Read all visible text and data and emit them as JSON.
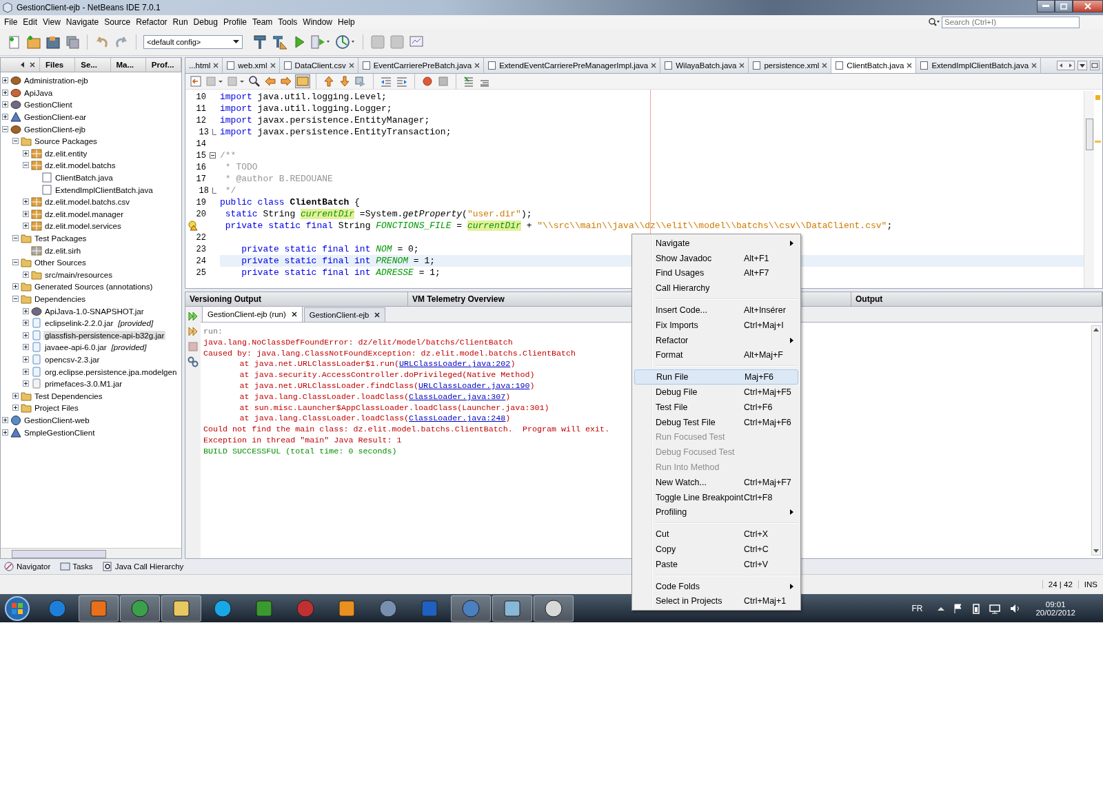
{
  "window": {
    "title": "GestionClient-ejb - NetBeans IDE 7.0.1"
  },
  "menu": [
    "File",
    "Edit",
    "View",
    "Navigate",
    "Source",
    "Refactor",
    "Run",
    "Debug",
    "Profile",
    "Team",
    "Tools",
    "Window",
    "Help"
  ],
  "search": {
    "placeholder": "Search (Ctrl+I)"
  },
  "toolbar": {
    "config": "<default config>"
  },
  "projects": {
    "tabs": [
      {
        "label": "Files",
        "selected": false
      },
      {
        "label": "Se...",
        "selected": false
      },
      {
        "label": "Ma...",
        "selected": false
      },
      {
        "label": "Prof...",
        "selected": false
      }
    ],
    "tree": [
      {
        "label": "Administration-ejb",
        "kind": "ejb",
        "expanded": false,
        "selected": false
      },
      {
        "label": "ApiJava",
        "kind": "javaapp",
        "expanded": false,
        "selected": false
      },
      {
        "label": "GestionClient",
        "kind": "maven",
        "expanded": false,
        "selected": false
      },
      {
        "label": "GestionClient-ear",
        "kind": "ear",
        "expanded": false,
        "selected": false
      },
      {
        "label": "GestionClient-ejb",
        "kind": "ejb",
        "expanded": true,
        "selected": false,
        "children": [
          {
            "label": "Source Packages",
            "kind": "folder",
            "expanded": true,
            "selected": false,
            "children": [
              {
                "label": "dz.elit.entity",
                "kind": "package",
                "expanded": false,
                "selected": false
              },
              {
                "label": "dz.elit.model.batchs",
                "kind": "package",
                "expanded": true,
                "selected": false,
                "children": [
                  {
                    "label": "ClientBatch.java",
                    "kind": "java",
                    "selected": false
                  },
                  {
                    "label": "ExtendImplClientBatch.java",
                    "kind": "java",
                    "selected": false
                  }
                ]
              },
              {
                "label": "dz.elit.model.batchs.csv",
                "kind": "package",
                "expanded": false,
                "selected": false
              },
              {
                "label": "dz.elit.model.manager",
                "kind": "package",
                "expanded": false,
                "selected": false
              },
              {
                "label": "dz.elit.model.services",
                "kind": "package",
                "expanded": false,
                "selected": false
              }
            ]
          },
          {
            "label": "Test Packages",
            "kind": "folder",
            "expanded": true,
            "selected": false,
            "children": [
              {
                "label": "dz.elit.sirh",
                "kind": "empty-package",
                "selected": false
              }
            ]
          },
          {
            "label": "Other Sources",
            "kind": "folder",
            "expanded": true,
            "selected": false,
            "children": [
              {
                "label": "src/main/resources",
                "kind": "folder",
                "expanded": false,
                "selected": false
              }
            ]
          },
          {
            "label": "Generated Sources (annotations)",
            "kind": "folder",
            "expanded": false,
            "selected": false
          },
          {
            "label": "Dependencies",
            "kind": "folder",
            "expanded": true,
            "selected": false,
            "children": [
              {
                "label": "ApiJava-1.0-SNAPSHOT.jar",
                "kind": "maven",
                "expanded": false,
                "selected": false
              },
              {
                "label": "eclipselink-2.2.0.jar",
                "note": "[provided]",
                "kind": "jar",
                "expanded": false,
                "selected": false
              },
              {
                "label": "glassfish-persistence-api-b32g.jar",
                "kind": "jar",
                "expanded": false,
                "selected": true
              },
              {
                "label": "javaee-api-6.0.jar",
                "note": "[provided]",
                "kind": "jar",
                "expanded": false,
                "selected": false
              },
              {
                "label": "opencsv-2.3.jar",
                "kind": "jar",
                "expanded": false,
                "selected": false
              },
              {
                "label": "org.eclipse.persistence.jpa.modelgen",
                "kind": "jar",
                "expanded": false,
                "selected": false
              },
              {
                "label": "primefaces-3.0.M1.jar",
                "kind": "jar-grey",
                "expanded": false,
                "selected": false
              }
            ]
          },
          {
            "label": "Test Dependencies",
            "kind": "folder",
            "expanded": false,
            "selected": false
          },
          {
            "label": "Project Files",
            "kind": "folder",
            "expanded": false,
            "selected": false
          }
        ]
      },
      {
        "label": "GestionClient-web",
        "kind": "web",
        "expanded": false,
        "selected": false
      },
      {
        "label": "SmpleGestionClient",
        "kind": "ear",
        "expanded": false,
        "selected": false
      }
    ]
  },
  "editor": {
    "tabs": [
      {
        "label": "...html",
        "selected": false
      },
      {
        "label": "web.xml",
        "selected": false
      },
      {
        "label": "DataClient.csv",
        "selected": false
      },
      {
        "label": "EventCarrierePreBatch.java",
        "selected": false
      },
      {
        "label": "ExtendEventCarrierePreManagerImpl.java",
        "selected": false
      },
      {
        "label": "WilayaBatch.java",
        "selected": false
      },
      {
        "label": "persistence.xml",
        "selected": false
      },
      {
        "label": "ClientBatch.java",
        "selected": true
      },
      {
        "label": "ExtendImplClientBatch.java",
        "selected": false
      }
    ],
    "lines": [
      {
        "number": "10",
        "kind": "plain",
        "current": false,
        "tokens": [
          {
            "kind": "kw",
            "text": "import"
          },
          {
            "kind": "plain",
            "text": " java.util.logging.Level;"
          }
        ]
      },
      {
        "number": "11",
        "kind": "plain",
        "current": false,
        "tokens": [
          {
            "kind": "kw",
            "text": "import"
          },
          {
            "kind": "plain",
            "text": " java.util.logging.Logger;"
          }
        ]
      },
      {
        "number": "12",
        "kind": "plain",
        "current": false,
        "tokens": [
          {
            "kind": "kw",
            "text": "import"
          },
          {
            "kind": "plain",
            "text": " javax.persistence.EntityManager;"
          }
        ]
      },
      {
        "number": "13",
        "kind": "fold-end",
        "current": false,
        "tokens": [
          {
            "kind": "kw",
            "text": "import"
          },
          {
            "kind": "plain",
            "text": " javax.persistence.EntityTransaction;"
          }
        ]
      },
      {
        "number": "14",
        "kind": "plain",
        "current": false
      },
      {
        "number": "15",
        "kind": "fold-start",
        "current": false,
        "tokens": [
          {
            "kind": "comment",
            "text": "/**"
          }
        ]
      },
      {
        "number": "16",
        "kind": "plain",
        "current": false,
        "tokens": [
          {
            "kind": "comment",
            "text": " * TODO"
          }
        ]
      },
      {
        "number": "17",
        "kind": "plain",
        "current": false,
        "tokens": [
          {
            "kind": "comment",
            "text": " * @author B.REDOUANE"
          }
        ]
      },
      {
        "number": "18",
        "kind": "fold-end",
        "current": false,
        "tokens": [
          {
            "kind": "comment",
            "text": " */"
          }
        ]
      },
      {
        "number": "19",
        "kind": "plain",
        "current": false,
        "tokens": [
          {
            "kind": "kw",
            "text": "public class "
          },
          {
            "kind": "bold",
            "text": "ClientBatch"
          },
          {
            "kind": "plain",
            "text": " {"
          }
        ]
      },
      {
        "number": "20",
        "kind": "plain",
        "current": false,
        "tokens": [
          {
            "kind": "kw",
            "text": " static"
          },
          {
            "kind": "plain",
            "text": " String "
          },
          {
            "kind": "mark",
            "text": "currentDir"
          },
          {
            "kind": "plain",
            "text": " =System."
          },
          {
            "kind": "italic",
            "text": "getProperty"
          },
          {
            "kind": "plain",
            "text": "("
          },
          {
            "kind": "string",
            "text": "\"user.dir\""
          },
          {
            "kind": "plain",
            "text": ");"
          }
        ]
      },
      {
        "kind": "warning",
        "current": false,
        "tokens": [
          {
            "kind": "kw",
            "text": " private static final"
          },
          {
            "kind": "plain",
            "text": " String "
          },
          {
            "kind": "field",
            "text": "FONCTIONS_FILE"
          },
          {
            "kind": "plain",
            "text": " = "
          },
          {
            "kind": "mark",
            "text": "currentDir"
          },
          {
            "kind": "plain",
            "text": " + "
          },
          {
            "kind": "string",
            "text": "\"\\\\src\\\\main\\\\java\\\\dz\\\\elit\\\\model\\\\batchs\\\\csv\\\\DataClient.csv\""
          },
          {
            "kind": "plain",
            "text": ";"
          }
        ]
      },
      {
        "number": "22",
        "kind": "plain",
        "current": false
      },
      {
        "number": "23",
        "kind": "plain",
        "current": false,
        "tokens": [
          {
            "kind": "kw",
            "text": "    private static final int "
          },
          {
            "kind": "field",
            "text": "NOM"
          },
          {
            "kind": "plain",
            "text": " = 0;"
          }
        ]
      },
      {
        "number": "24",
        "kind": "plain",
        "current": true,
        "tokens": [
          {
            "kind": "kw",
            "text": "    private static final int "
          },
          {
            "kind": "field",
            "text": "PRENOM"
          },
          {
            "kind": "plain",
            "text": " = 1;"
          }
        ]
      },
      {
        "number": "25",
        "kind": "plain",
        "current": false,
        "tokens": [
          {
            "kind": "kw",
            "text": "    private static final int "
          },
          {
            "kind": "field",
            "text": "ADRESSE"
          },
          {
            "kind": "plain",
            "text": " = 1;"
          }
        ]
      }
    ]
  },
  "panels": [
    "Versioning Output",
    "VM Telemetry Overview",
    "Output"
  ],
  "output": {
    "tabs": [
      {
        "label": "GestionClient-ejb (run)",
        "selected": true
      },
      {
        "label": "GestionClient-ejb",
        "selected": false
      }
    ],
    "lines": [
      {
        "kind": "info",
        "parts": [
          {
            "text": "run:"
          }
        ]
      },
      {
        "kind": "error",
        "parts": [
          {
            "text": "java.lang.NoClassDefFoundError: dz/elit/model/batchs/ClientBatch"
          }
        ]
      },
      {
        "kind": "error",
        "parts": [
          {
            "text": "Caused by: java.lang.ClassNotFoundException: dz.elit.model.batchs.ClientBatch"
          }
        ]
      },
      {
        "kind": "trace",
        "parts": [
          {
            "text": "at java.net.URLClassLoader$1.run("
          },
          {
            "text": "URLClassLoader.java:202",
            "link": true
          },
          {
            "text": ")"
          }
        ]
      },
      {
        "kind": "trace",
        "parts": [
          {
            "text": "at java.security.AccessController.doPrivileged(Native Method)"
          }
        ]
      },
      {
        "kind": "trace",
        "parts": [
          {
            "text": "at java.net.URLClassLoader.findClass("
          },
          {
            "text": "URLClassLoader.java:190",
            "link": true
          },
          {
            "text": ")"
          }
        ]
      },
      {
        "kind": "trace",
        "parts": [
          {
            "text": "at java.lang.ClassLoader.loadClass("
          },
          {
            "text": "ClassLoader.java:307",
            "link": true
          },
          {
            "text": ")"
          }
        ]
      },
      {
        "kind": "trace",
        "parts": [
          {
            "text": "at sun.misc.Launcher$AppClassLoader.loadClass(Launcher.java:301)"
          }
        ]
      },
      {
        "kind": "trace",
        "parts": [
          {
            "text": "at java.lang.ClassLoader.loadClass("
          },
          {
            "text": "ClassLoader.java:248",
            "link": true
          },
          {
            "text": ")"
          }
        ]
      },
      {
        "kind": "error",
        "parts": [
          {
            "text": "Could not find the main class: dz.elit.model.batchs.ClientBatch.  Program will exit."
          }
        ]
      },
      {
        "kind": "error",
        "parts": [
          {
            "text": "Exception in thread \"main\" Java Result: 1"
          }
        ]
      },
      {
        "kind": "success",
        "parts": [
          {
            "text": "BUILD SUCCESSFUL (total time: 0 seconds)"
          }
        ]
      }
    ]
  },
  "bottom_tabs": [
    "Navigator",
    "Tasks",
    "Java Call Hierarchy"
  ],
  "status_bar": {
    "position": "24 | 42",
    "mode": "INS"
  },
  "tray": {
    "language": "FR",
    "time": "09:01",
    "date": "20/02/2012"
  },
  "context_menu": [
    [
      {
        "label": "Navigate",
        "submenu": true,
        "disabled": false,
        "selected": false
      },
      {
        "label": "Show Javadoc",
        "shortcut": "Alt+F1",
        "submenu": false,
        "disabled": false,
        "selected": false
      },
      {
        "label": "Find Usages",
        "shortcut": "Alt+F7",
        "submenu": false,
        "disabled": false,
        "selected": false
      },
      {
        "label": "Call Hierarchy",
        "submenu": false,
        "disabled": false,
        "selected": false
      }
    ],
    [
      {
        "label": "Insert Code...",
        "shortcut": "Alt+Insérer",
        "submenu": false,
        "disabled": false,
        "selected": false
      },
      {
        "label": "Fix Imports",
        "shortcut": "Ctrl+Maj+I",
        "submenu": false,
        "disabled": false,
        "selected": false
      },
      {
        "label": "Refactor",
        "submenu": true,
        "disabled": false,
        "selected": false
      },
      {
        "label": "Format",
        "shortcut": "Alt+Maj+F",
        "submenu": false,
        "disabled": false,
        "selected": false
      }
    ],
    [
      {
        "label": "Run File",
        "shortcut": "Maj+F6",
        "submenu": false,
        "disabled": false,
        "selected": true
      },
      {
        "label": "Debug File",
        "shortcut": "Ctrl+Maj+F5",
        "submenu": false,
        "disabled": false,
        "selected": false
      },
      {
        "label": "Test File",
        "shortcut": "Ctrl+F6",
        "submenu": false,
        "disabled": false,
        "selected": false
      },
      {
        "label": "Debug Test File",
        "shortcut": "Ctrl+Maj+F6",
        "submenu": false,
        "disabled": false,
        "selected": false
      },
      {
        "label": "Run Focused Test",
        "submenu": false,
        "disabled": true,
        "selected": false
      },
      {
        "label": "Debug Focused Test",
        "submenu": false,
        "disabled": true,
        "selected": false
      },
      {
        "label": "Run Into Method",
        "submenu": false,
        "disabled": true,
        "selected": false
      },
      {
        "label": "New Watch...",
        "shortcut": "Ctrl+Maj+F7",
        "submenu": false,
        "disabled": false,
        "selected": false
      },
      {
        "label": "Toggle Line Breakpoint",
        "shortcut": "Ctrl+F8",
        "submenu": false,
        "disabled": false,
        "selected": false
      },
      {
        "label": "Profiling",
        "submenu": true,
        "disabled": false,
        "selected": false
      }
    ],
    [
      {
        "label": "Cut",
        "shortcut": "Ctrl+X",
        "submenu": false,
        "disabled": false,
        "selected": false
      },
      {
        "label": "Copy",
        "shortcut": "Ctrl+C",
        "submenu": false,
        "disabled": false,
        "selected": false
      },
      {
        "label": "Paste",
        "shortcut": "Ctrl+V",
        "submenu": false,
        "disabled": false,
        "selected": false
      }
    ],
    [
      {
        "label": "Code Folds",
        "submenu": true,
        "disabled": false,
        "selected": false
      },
      {
        "label": "Select in Projects",
        "shortcut": "Ctrl+Maj+1",
        "submenu": false,
        "disabled": false,
        "selected": false
      }
    ]
  ]
}
